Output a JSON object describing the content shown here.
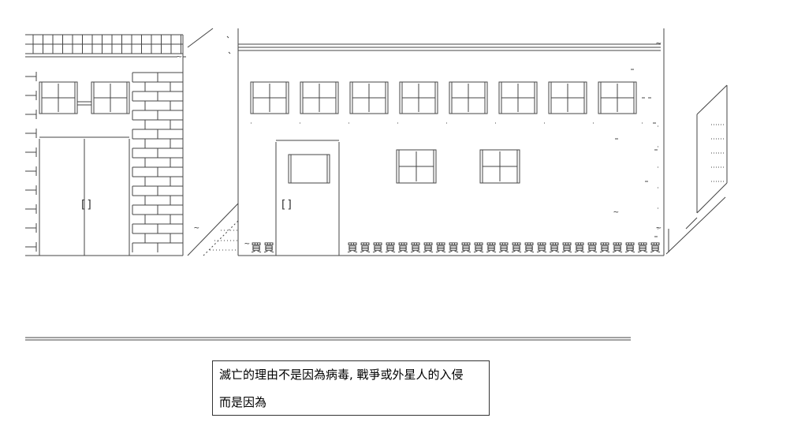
{
  "caption": {
    "line1": "滅亡的理由不是因為病毒, 戰爭或外星人的入侵",
    "line2": "而是因為"
  },
  "art": {
    "door_handle_left": "[]",
    "door_handle_right": "[]",
    "fence_glyph": "買",
    "tilde": "~"
  }
}
